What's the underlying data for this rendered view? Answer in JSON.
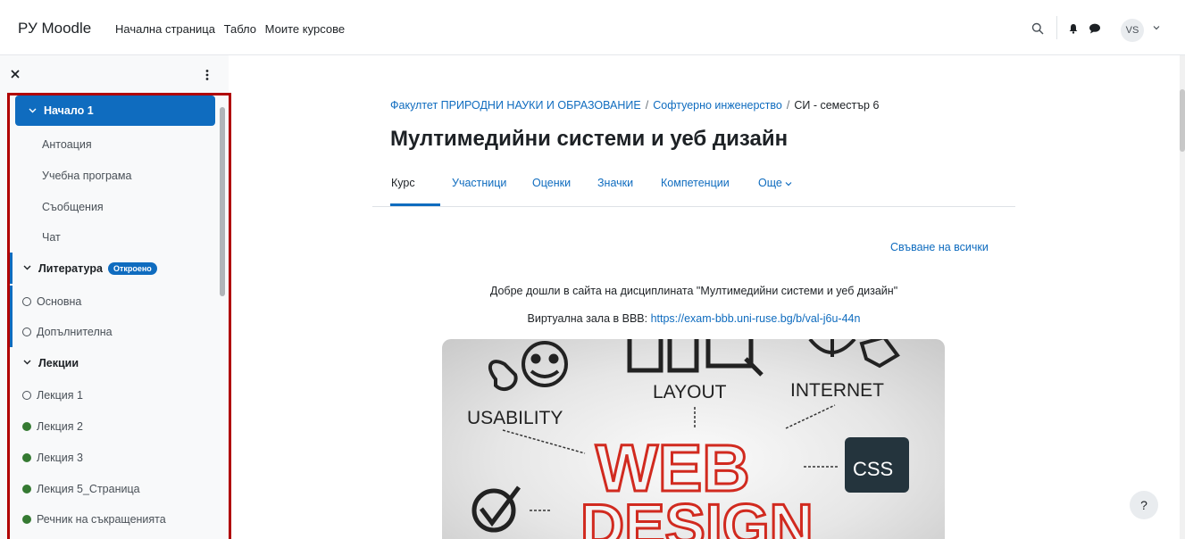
{
  "navbar": {
    "brand": "РУ Moodle",
    "links": [
      "Начална страница",
      "Табло",
      "Моите курсове"
    ],
    "user_initials": "VS",
    "icons": [
      "search-icon",
      "bell-icon",
      "chat-icon",
      "chevron-down-icon"
    ]
  },
  "drawer": {
    "items": [
      {
        "label": "Начало 1",
        "type": "section",
        "active": true
      },
      {
        "label": "Антоация",
        "type": "sub"
      },
      {
        "label": "Учебна програма",
        "type": "sub"
      },
      {
        "label": "Съобщения",
        "type": "sub"
      },
      {
        "label": "Чат",
        "type": "sub"
      },
      {
        "label": "Литература",
        "type": "section",
        "badge": "Откроено"
      },
      {
        "label": "Основна",
        "type": "activity",
        "done": false
      },
      {
        "label": "Допълнителна",
        "type": "activity",
        "done": false
      },
      {
        "label": "Лекции",
        "type": "section"
      },
      {
        "label": "Лекция 1",
        "type": "activity",
        "done": false
      },
      {
        "label": "Лекция 2",
        "type": "activity",
        "done": true
      },
      {
        "label": "Лекция 3",
        "type": "activity",
        "done": true
      },
      {
        "label": "Лекция 5_Страница",
        "type": "activity",
        "done": true
      },
      {
        "label": "Речник на съкращенията",
        "type": "activity",
        "done": true
      }
    ]
  },
  "breadcrumb": {
    "items": [
      "Факултет ПРИРОДНИ НАУКИ И ОБРАЗОВАНИЕ",
      "Софтуерно инженерство"
    ],
    "current": "СИ - семестър 6",
    "separator": "/"
  },
  "page_title": "Мултимедийни системи и уеб дизайн",
  "tabs": [
    "Курс",
    "Участници",
    "Оценки",
    "Значки",
    "Компетенции",
    "Още"
  ],
  "collapse_all": "Свъване на всички",
  "welcome_text": "Добре дошли в сайта на дисциплината \"Мултимедийни системи и уеб дизайн\"",
  "virtual_room": {
    "label": "Виртуална зала в BBB:",
    "url": "https://exam-bbb.uni-ruse.bg/b/val-j6u-44n"
  },
  "banner": {
    "words": [
      "LAYOUT",
      "INTERNET",
      "USABILITY",
      "WEB",
      "CSS",
      "DESIGN"
    ]
  },
  "help_label": "?",
  "colors": {
    "accent": "#0f6cbf",
    "completed": "#357a32",
    "highlight_border": "#b00000"
  }
}
